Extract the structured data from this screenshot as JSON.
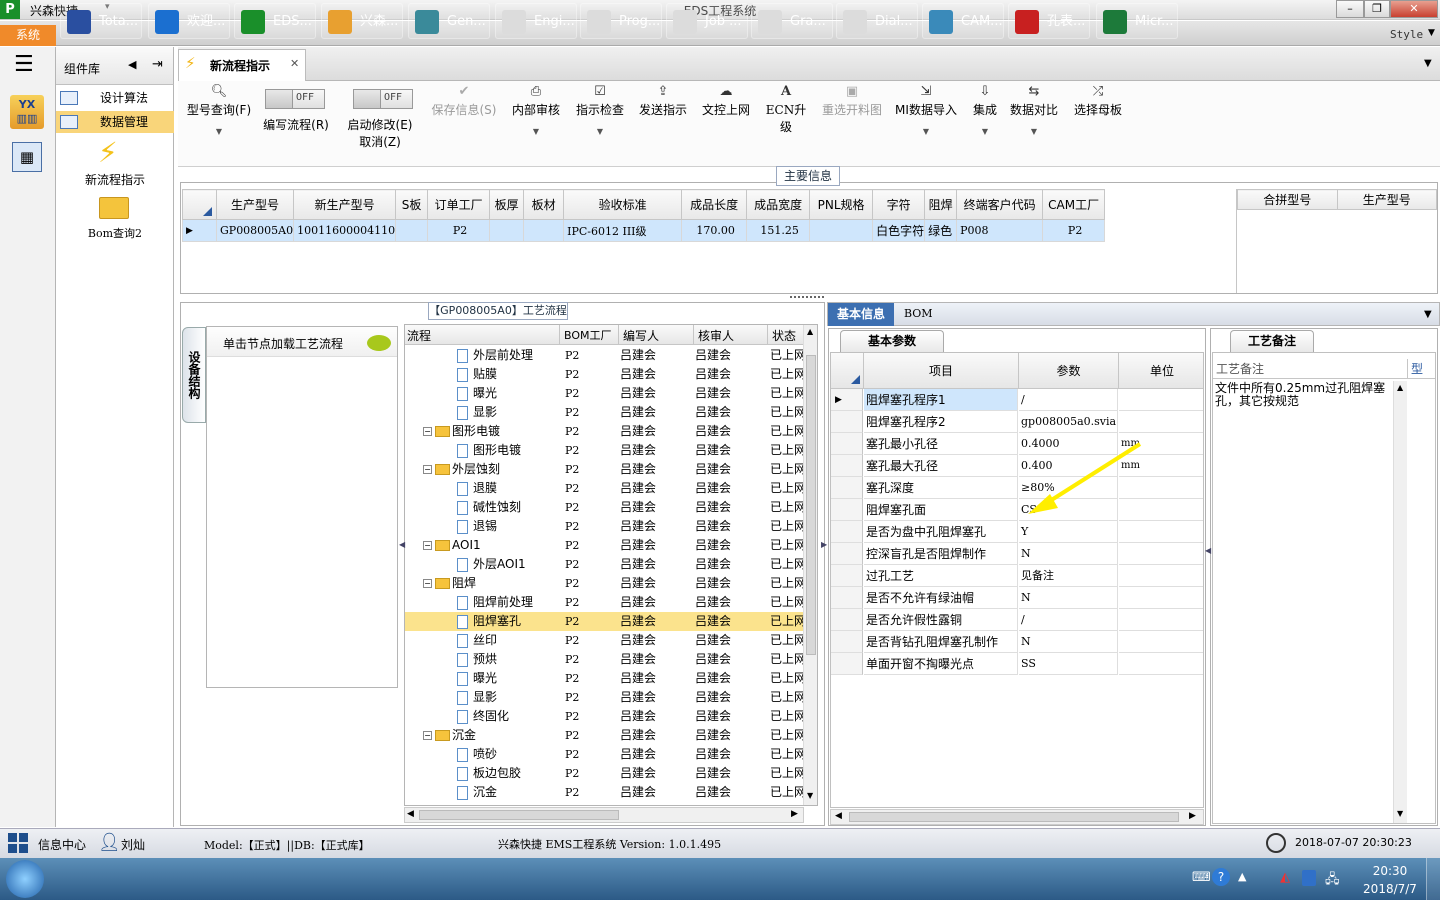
{
  "window": {
    "app_name": "兴森快捷",
    "title": "EDS工程系统",
    "style_label": "Style"
  },
  "menu": {
    "system_tab": "系统"
  },
  "component_library": {
    "title": "组件库",
    "items": [
      "设计算法",
      "数据管理",
      "新流程指示",
      "Bom查询2"
    ]
  },
  "tabs": [
    {
      "label": "新流程指示"
    }
  ],
  "toolbar": {
    "buttons": [
      {
        "label": "型号查询(F)",
        "icon": "search-icon"
      },
      {
        "label": "编写流程(R)",
        "toggle": "OFF"
      },
      {
        "label": "启动修改(E)",
        "sublabel": "取消(Z)",
        "toggle": "OFF"
      },
      {
        "label": "保存信息(S)",
        "icon": "check-icon",
        "disabled": true
      },
      {
        "label": "内部审核",
        "icon": "printer-icon"
      },
      {
        "label": "指示检查",
        "icon": "check-box-icon"
      },
      {
        "label": "发送指示",
        "icon": "upload-icon"
      },
      {
        "label": "文控上网",
        "icon": "cloud-upload-icon"
      },
      {
        "label": "ECN升级",
        "icon": "ecn-icon"
      },
      {
        "label": "重选开料图",
        "icon": "image-icon",
        "disabled": true
      },
      {
        "label": "MI数据导入",
        "icon": "import-icon"
      },
      {
        "label": "集成",
        "icon": "download-icon"
      },
      {
        "label": "数据对比",
        "icon": "compare-icon"
      },
      {
        "label": "选择母板",
        "icon": "shuffle-icon"
      }
    ]
  },
  "main_info": {
    "title": "主要信息",
    "columns": [
      "生产型号",
      "新生产型号",
      "S板",
      "订单工厂",
      "板厚",
      "板材",
      "验收标准",
      "成品长度",
      "成品宽度",
      "PNL规格",
      "字符",
      "阻焊",
      "终端客户代码",
      "CAM工厂"
    ],
    "row": [
      "GP008005A0",
      "10011600004110",
      "",
      "P2",
      "",
      "",
      "IPC-6012 III级",
      "170.00",
      "151.25",
      "",
      "白色字符",
      "绿色",
      "P008",
      "P2"
    ],
    "side_columns": [
      "合拼型号",
      "生产型号"
    ]
  },
  "process": {
    "title": "【GP008005A0】工艺流程",
    "vertical_tab": "设备结构",
    "load_hint": "单击节点加载工艺流程",
    "columns": [
      "流程",
      "BOM工厂",
      "编写人",
      "核审人",
      "状态"
    ],
    "rows": [
      {
        "name": "外层前处理",
        "level": 2,
        "type": "doc",
        "factory": "P2",
        "writer": "吕建会",
        "reviewer": "吕建会",
        "status": "已上网"
      },
      {
        "name": "贴膜",
        "level": 2,
        "type": "doc",
        "factory": "P2",
        "writer": "吕建会",
        "reviewer": "吕建会",
        "status": "已上网"
      },
      {
        "name": "曝光",
        "level": 2,
        "type": "doc",
        "factory": "P2",
        "writer": "吕建会",
        "reviewer": "吕建会",
        "status": "已上网"
      },
      {
        "name": "显影",
        "level": 2,
        "type": "doc",
        "factory": "P2",
        "writer": "吕建会",
        "reviewer": "吕建会",
        "status": "已上网"
      },
      {
        "name": "图形电镀",
        "level": 1,
        "type": "folder",
        "factory": "P2",
        "writer": "吕建会",
        "reviewer": "吕建会",
        "status": "已上网"
      },
      {
        "name": "图形电镀",
        "level": 2,
        "type": "doc",
        "factory": "P2",
        "writer": "吕建会",
        "reviewer": "吕建会",
        "status": "已上网"
      },
      {
        "name": "外层蚀刻",
        "level": 1,
        "type": "folder",
        "factory": "P2",
        "writer": "吕建会",
        "reviewer": "吕建会",
        "status": "已上网"
      },
      {
        "name": "退膜",
        "level": 2,
        "type": "doc",
        "factory": "P2",
        "writer": "吕建会",
        "reviewer": "吕建会",
        "status": "已上网"
      },
      {
        "name": "碱性蚀刻",
        "level": 2,
        "type": "doc",
        "factory": "P2",
        "writer": "吕建会",
        "reviewer": "吕建会",
        "status": "已上网"
      },
      {
        "name": "退锡",
        "level": 2,
        "type": "doc",
        "factory": "P2",
        "writer": "吕建会",
        "reviewer": "吕建会",
        "status": "已上网"
      },
      {
        "name": "AOI1",
        "level": 1,
        "type": "folder",
        "factory": "P2",
        "writer": "吕建会",
        "reviewer": "吕建会",
        "status": "已上网"
      },
      {
        "name": "外层AOI1",
        "level": 2,
        "type": "doc",
        "factory": "P2",
        "writer": "吕建会",
        "reviewer": "吕建会",
        "status": "已上网"
      },
      {
        "name": "阻焊",
        "level": 1,
        "type": "folder",
        "factory": "P2",
        "writer": "吕建会",
        "reviewer": "吕建会",
        "status": "已上网"
      },
      {
        "name": "阻焊前处理",
        "level": 2,
        "type": "doc",
        "factory": "P2",
        "writer": "吕建会",
        "reviewer": "吕建会",
        "status": "已上网"
      },
      {
        "name": "阻焊塞孔",
        "level": 2,
        "type": "doc",
        "factory": "P2",
        "writer": "吕建会",
        "reviewer": "吕建会",
        "status": "已上网",
        "selected": true
      },
      {
        "name": "丝印",
        "level": 2,
        "type": "doc",
        "factory": "P2",
        "writer": "吕建会",
        "reviewer": "吕建会",
        "status": "已上网"
      },
      {
        "name": "预烘",
        "level": 2,
        "type": "doc",
        "factory": "P2",
        "writer": "吕建会",
        "reviewer": "吕建会",
        "status": "已上网"
      },
      {
        "name": "曝光",
        "level": 2,
        "type": "doc",
        "factory": "P2",
        "writer": "吕建会",
        "reviewer": "吕建会",
        "status": "已上网"
      },
      {
        "name": "显影",
        "level": 2,
        "type": "doc",
        "factory": "P2",
        "writer": "吕建会",
        "reviewer": "吕建会",
        "status": "已上网"
      },
      {
        "name": "终固化",
        "level": 2,
        "type": "doc",
        "factory": "P2",
        "writer": "吕建会",
        "reviewer": "吕建会",
        "status": "已上网"
      },
      {
        "name": "沉金",
        "level": 1,
        "type": "folder",
        "factory": "P2",
        "writer": "吕建会",
        "reviewer": "吕建会",
        "status": "已上网"
      },
      {
        "name": "喷砂",
        "level": 2,
        "type": "doc",
        "factory": "P2",
        "writer": "吕建会",
        "reviewer": "吕建会",
        "status": "已上网"
      },
      {
        "name": "板边包胶",
        "level": 2,
        "type": "doc",
        "factory": "P2",
        "writer": "吕建会",
        "reviewer": "吕建会",
        "status": "已上网"
      },
      {
        "name": "沉金",
        "level": 2,
        "type": "doc",
        "factory": "P2",
        "writer": "吕建会",
        "reviewer": "吕建会",
        "status": "已上网"
      }
    ]
  },
  "detail": {
    "tabs": [
      "基本信息",
      "BOM"
    ],
    "subtab": "基本参数",
    "columns": [
      "项目",
      "参数",
      "单位"
    ],
    "rows": [
      {
        "item": "阻焊塞孔程序1",
        "param": "/",
        "unit": ""
      },
      {
        "item": "阻焊塞孔程序2",
        "param": "gp008005a0.svia",
        "unit": ""
      },
      {
        "item": "塞孔最小孔径",
        "param": "0.4000",
        "unit": "mm"
      },
      {
        "item": "塞孔最大孔径",
        "param": "0.400",
        "unit": "mm"
      },
      {
        "item": "塞孔深度",
        "param": "≥80%",
        "unit": ""
      },
      {
        "item": "阻焊塞孔面",
        "param": "CS",
        "unit": ""
      },
      {
        "item": "是否为盘中孔阻焊塞孔",
        "param": "Y",
        "unit": ""
      },
      {
        "item": "控深盲孔是否阻焊制作",
        "param": "N",
        "unit": ""
      },
      {
        "item": "过孔工艺",
        "param": "见备注",
        "unit": ""
      },
      {
        "item": "是否不允许有绿油帽",
        "param": "N",
        "unit": ""
      },
      {
        "item": "是否允许假性露铜",
        "param": "/",
        "unit": ""
      },
      {
        "item": "是否背钻孔阻焊塞孔制作",
        "param": "N",
        "unit": ""
      },
      {
        "item": "单面开窗不掏曝光点",
        "param": "SS",
        "unit": ""
      }
    ]
  },
  "remarks": {
    "tab": "工艺备注",
    "col1": "工艺备注",
    "col2": "型",
    "text": "文件中所有0.25mm过孔阻焊塞孔，其它按规范"
  },
  "status": {
    "info_center": "信息中心",
    "user": "刘灿",
    "model": "Model:【正式】||DB:【正式库】",
    "version": "兴森快捷 EMS工程系统 Version: 1.0.1.495",
    "datetime": "2018-07-07 20:30:23"
  },
  "taskbar": {
    "items": [
      "Tota...",
      "欢迎...",
      "EDS...",
      "兴森...",
      "Gen...",
      "Engi...",
      "Prog...",
      "Job ...",
      "Gra...",
      "Dial...",
      "CAM...",
      "孔表...",
      "Micr..."
    ],
    "time": "20:30",
    "date": "2018/7/7"
  },
  "colors": {
    "accent": "#f08a2a",
    "selection": "#cfe6fc",
    "tree_selection": "#fbe38d",
    "arrow": "#ffee00"
  }
}
